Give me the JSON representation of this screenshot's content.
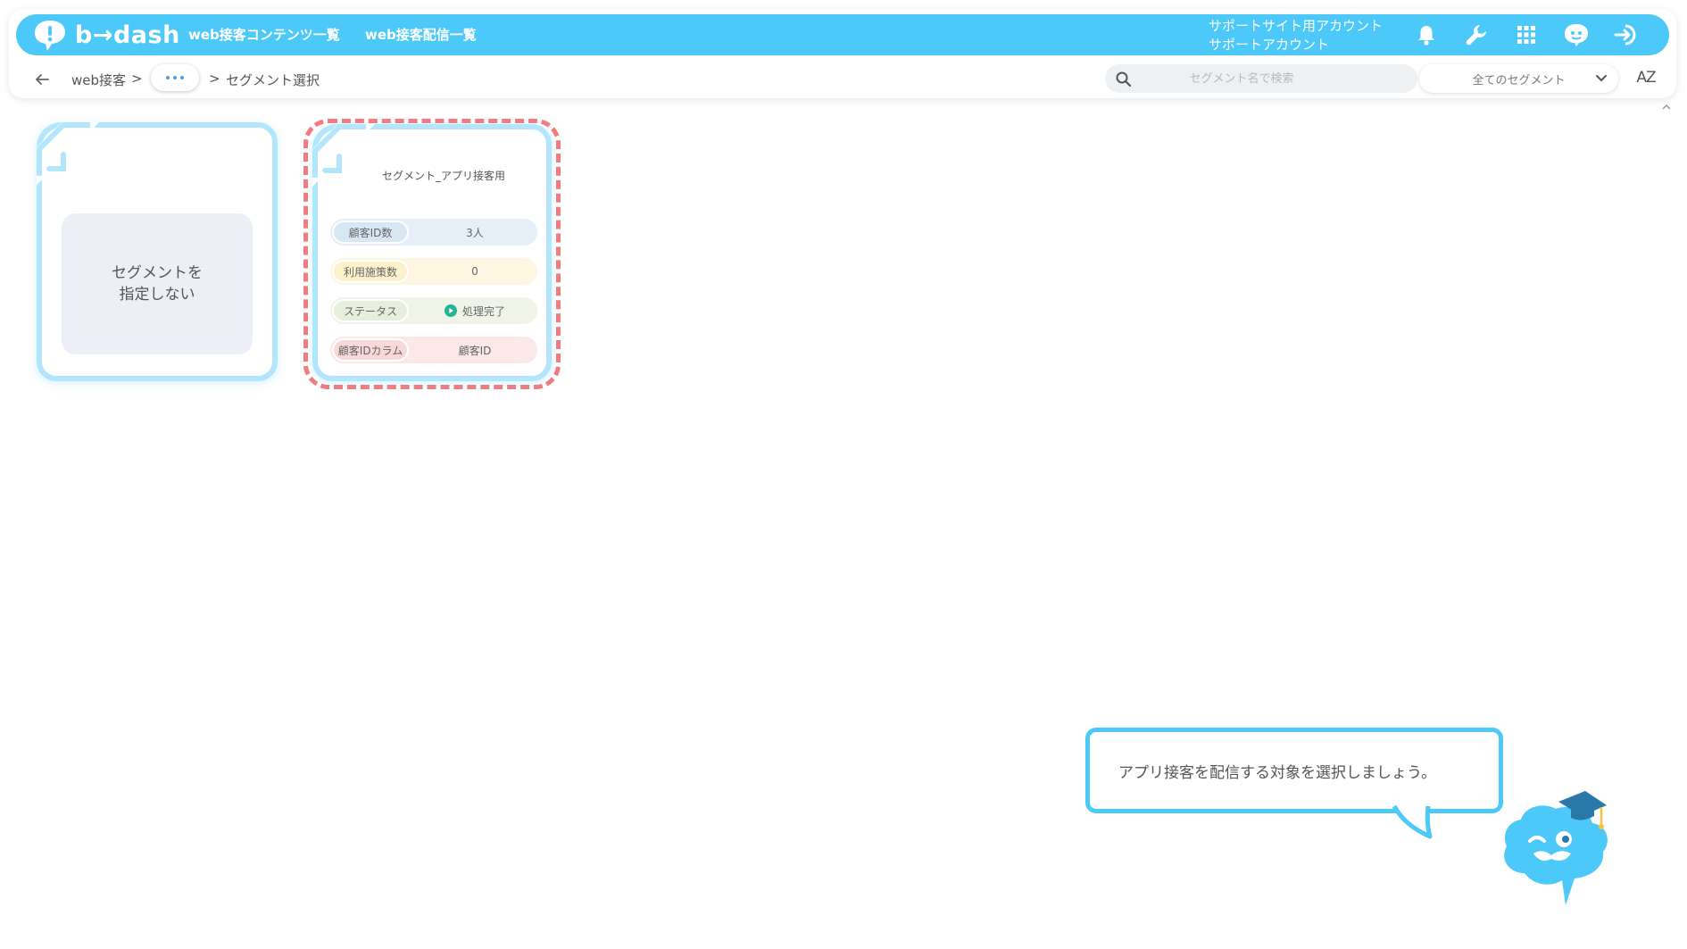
{
  "app": {
    "brand": "b→dash",
    "colors": {
      "accent": "#4cc8f9",
      "highlight_dash": "#f47b7f",
      "status_done": "#27b394"
    }
  },
  "header": {
    "nav": [
      "web接客コンテンツ一覧",
      "web接客配信一覧"
    ],
    "account_lines": [
      "サポートサイト用アカウント",
      "サポートアカウント"
    ],
    "icons": [
      "bell-icon",
      "wrench-icon",
      "grid-icon",
      "chat-mascot-icon",
      "logout-icon"
    ]
  },
  "subbar": {
    "breadcrumb": {
      "root": "web接客",
      "sep": ">",
      "current": "セグメント選択"
    },
    "search": {
      "placeholder": "セグメント名で検索",
      "value": ""
    },
    "filter": {
      "selected": "全てのセグメント"
    },
    "sort_label": "AZ"
  },
  "cards": {
    "no_segment": {
      "label": "セグメントを\n指定しない"
    },
    "segment": {
      "name": "セグメント_アプリ接客用",
      "stats": [
        {
          "label": "顧客ID数",
          "value": "3人"
        },
        {
          "label": "利用施策数",
          "value": "0"
        },
        {
          "label": "ステータス",
          "value": "処理完了"
        },
        {
          "label": "顧客IDカラム",
          "value": "顧客ID"
        }
      ]
    }
  },
  "guide": {
    "message": "アプリ接客を配信する対象を選択しましょう。"
  }
}
